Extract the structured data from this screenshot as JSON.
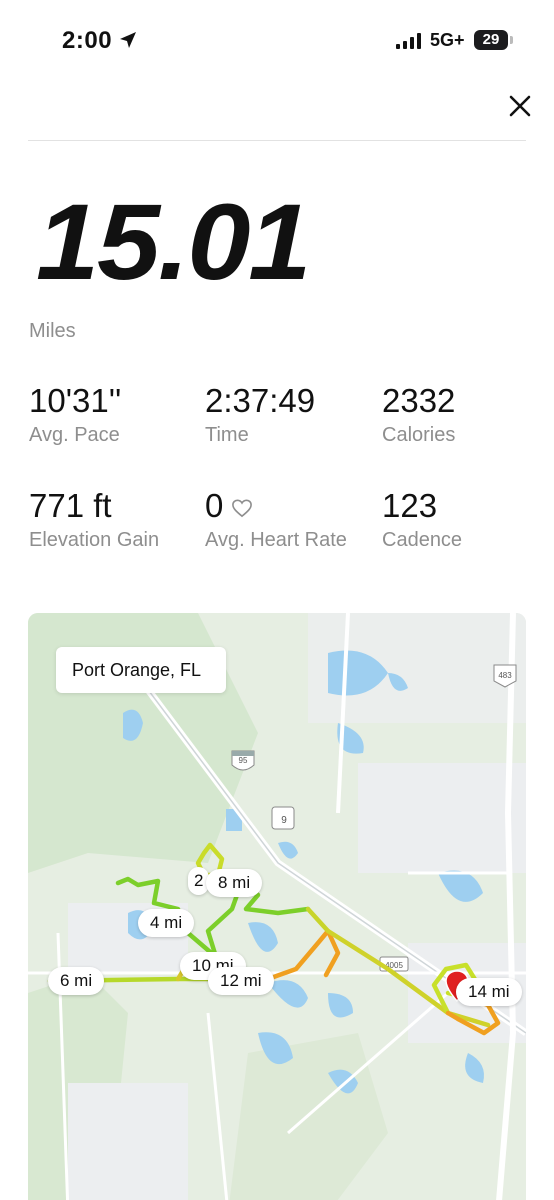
{
  "status_bar": {
    "time": "2:00",
    "network": "5G+",
    "battery": "29"
  },
  "run": {
    "distance": "15.01",
    "distance_unit": "Miles"
  },
  "stats": [
    {
      "value": "10'31''",
      "label": "Avg. Pace"
    },
    {
      "value": "2:37:49",
      "label": "Time"
    },
    {
      "value": "2332",
      "label": "Calories"
    },
    {
      "value": "771 ft",
      "label": "Elevation Gain"
    },
    {
      "value": "0",
      "label": "Avg. Heart Rate",
      "icon": "heart-outline-icon"
    },
    {
      "value": "123",
      "label": "Cadence"
    }
  ],
  "map": {
    "location": "Port Orange, FL",
    "highway_labels": [
      "95",
      "9",
      "483",
      "4005"
    ],
    "mile_markers": [
      "2",
      "4 mi",
      "6 mi",
      "8 mi",
      "10 mi",
      "12 mi",
      "14 mi"
    ],
    "colors": {
      "route_green": "#7ccf2a",
      "route_yellow": "#d8e02a",
      "route_orange": "#f0a020",
      "land": "#e8efe4",
      "water": "#9ecff0"
    }
  }
}
